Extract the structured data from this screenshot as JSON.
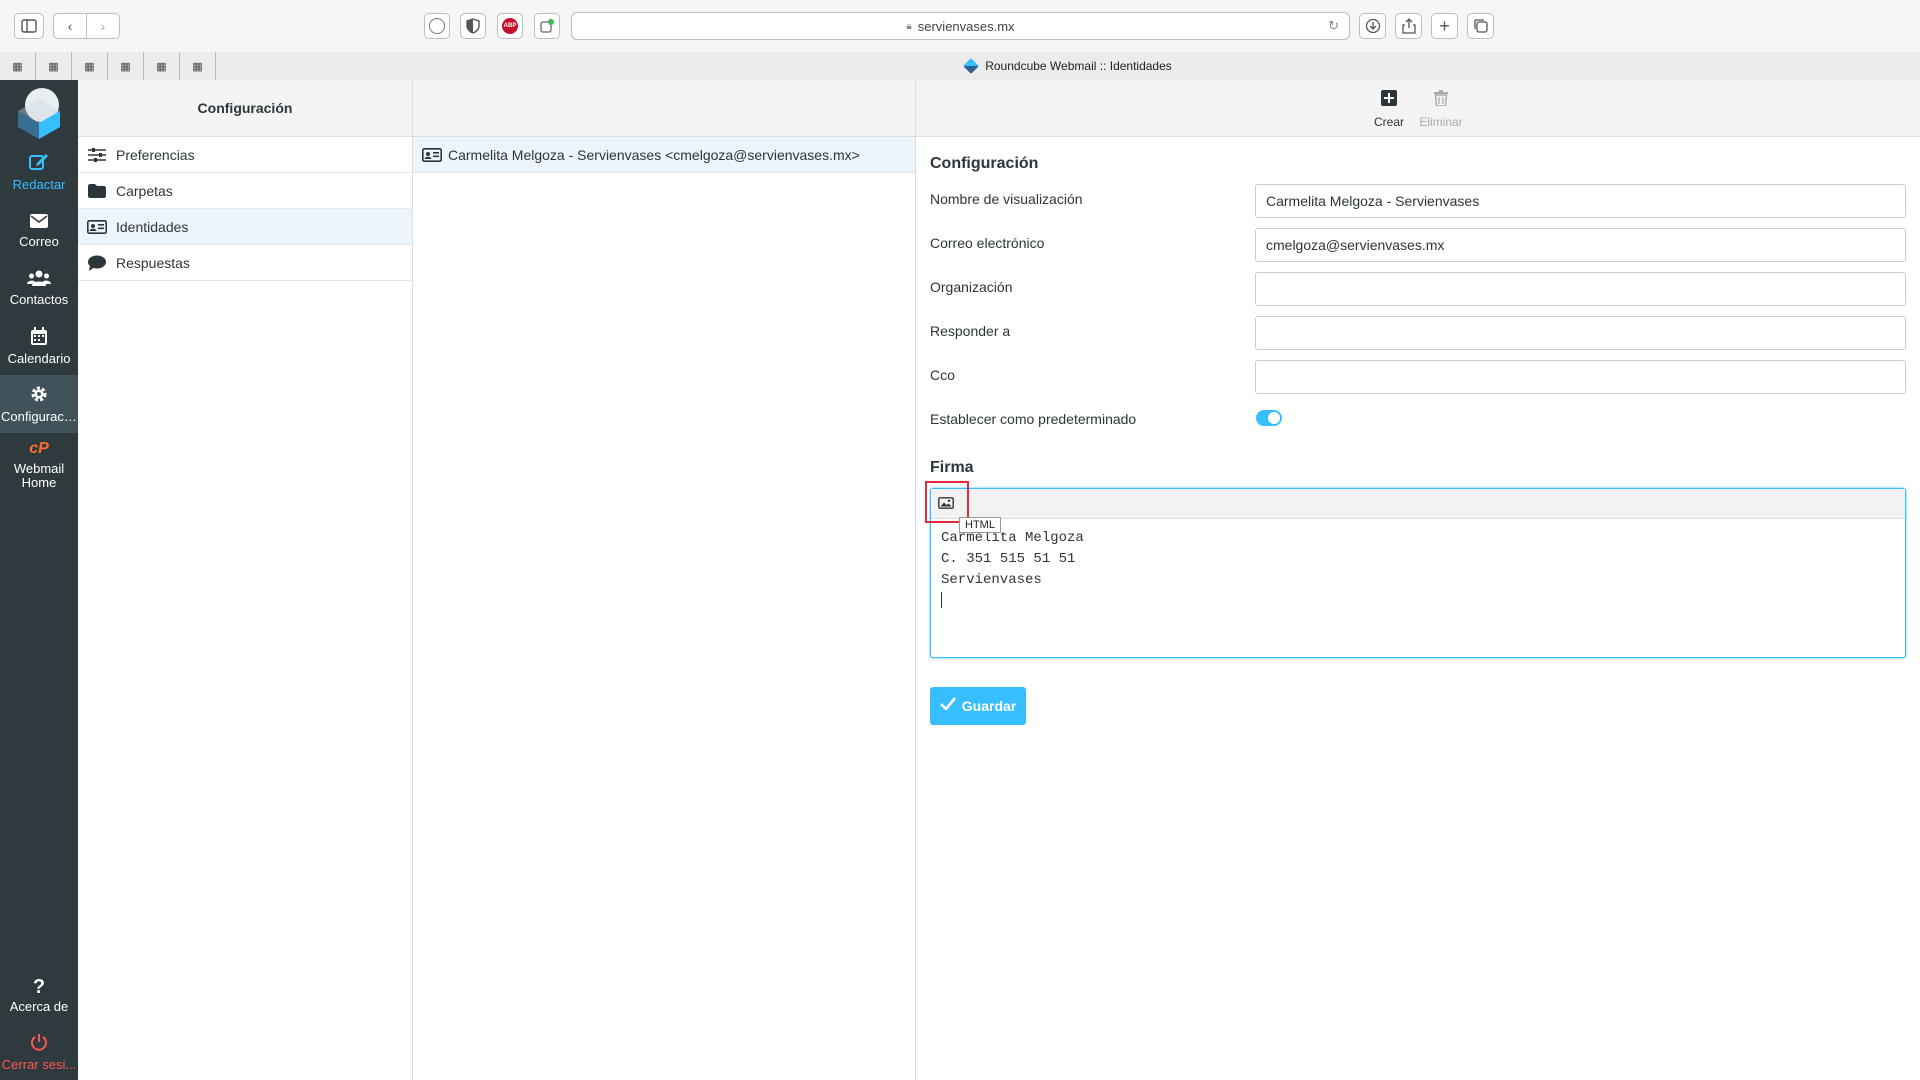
{
  "browser": {
    "url": "servienvases.mx",
    "tab_title": "Roundcube Webmail :: Identidades"
  },
  "nav": {
    "items": [
      {
        "label": "Redactar"
      },
      {
        "label": "Correo"
      },
      {
        "label": "Contactos"
      },
      {
        "label": "Calendario"
      },
      {
        "label": "Configuraci..."
      },
      {
        "label": "Webmail Home"
      }
    ],
    "bottom": [
      {
        "label": "Acerca de"
      },
      {
        "label": "Cerrar sesi..."
      }
    ]
  },
  "settings": {
    "header": "Configuración",
    "menu": [
      {
        "label": "Preferencias"
      },
      {
        "label": "Carpetas"
      },
      {
        "label": "Identidades"
      },
      {
        "label": "Respuestas"
      }
    ]
  },
  "identities": {
    "rows": [
      {
        "label": "Carmelita Melgoza - Servienvases <cmelgoza@servienvases.mx>"
      }
    ]
  },
  "toolbar": {
    "create_label": "Crear",
    "delete_label": "Eliminar"
  },
  "form": {
    "section_title": "Configuración",
    "display_name_label": "Nombre de visualización",
    "display_name_value": "Carmelita Melgoza - Servienvases",
    "email_label": "Correo electrónico",
    "email_value": "cmelgoza@servienvases.mx",
    "organization_label": "Organización",
    "organization_value": "",
    "reply_to_label": "Responder a",
    "reply_to_value": "",
    "bcc_label": "Cco",
    "bcc_value": "",
    "default_label": "Establecer como predeterminado",
    "default_checked": true,
    "signature_title": "Firma",
    "signature_lines": [
      "Carmelita Melgoza",
      "C. 351 515 51 51",
      "Servienvases"
    ],
    "html_tooltip": "HTML",
    "save_label": "Guardar"
  },
  "colors": {
    "accent": "#37beff",
    "nav_bg": "#2f3a3f",
    "logout": "#ff5552",
    "highlight": "#e02b3c"
  }
}
